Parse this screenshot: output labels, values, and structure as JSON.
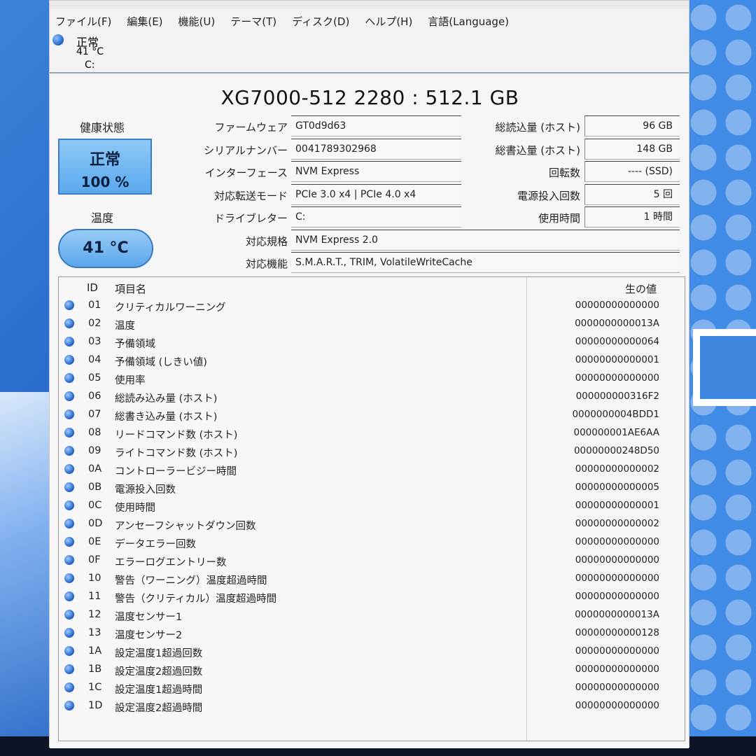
{
  "menu": [
    "ファイル(F)",
    "編集(E)",
    "機能(U)",
    "テーマ(T)",
    "ディスク(D)",
    "ヘルプ(H)",
    "言語(Language)"
  ],
  "drive_tab": {
    "status": "正常",
    "temperature": "41 °C",
    "letter": "C:"
  },
  "disk_title": "XG7000-512 2280 : 512.1 GB",
  "health": {
    "label": "健康状態",
    "status": "正常",
    "percent": "100 %"
  },
  "temperature": {
    "label": "温度",
    "value": "41 °C"
  },
  "info": {
    "firmware": {
      "label": "ファームウェア",
      "value": "GT0d9d63"
    },
    "serial": {
      "label": "シリアルナンバー",
      "value": "0041789302968"
    },
    "interface": {
      "label": "インターフェース",
      "value": "NVM Express"
    },
    "transfer_mode": {
      "label": "対応転送モード",
      "value": "PCIe 3.0 x4 | PCIe 4.0 x4"
    },
    "drive_letter": {
      "label": "ドライブレター",
      "value": "C:"
    },
    "standard": {
      "label": "対応規格",
      "value": "NVM Express 2.0"
    },
    "features": {
      "label": "対応機能",
      "value": "S.M.A.R.T., TRIM, VolatileWriteCache"
    }
  },
  "stats": {
    "host_reads": {
      "label": "総読込量 (ホスト)",
      "value": "96 GB"
    },
    "host_writes": {
      "label": "総書込量 (ホスト)",
      "value": "148 GB"
    },
    "rotation": {
      "label": "回転数",
      "value": "---- (SSD)"
    },
    "power_on_count": {
      "label": "電源投入回数",
      "value": "5 回"
    },
    "power_on_hours": {
      "label": "使用時間",
      "value": "1 時間"
    }
  },
  "smart": {
    "headers": {
      "id": "ID",
      "name": "項目名",
      "raw": "生の値"
    },
    "rows": [
      {
        "id": "01",
        "name": "クリティカルワーニング",
        "raw": "00000000000000"
      },
      {
        "id": "02",
        "name": "温度",
        "raw": "0000000000013A"
      },
      {
        "id": "03",
        "name": "予備領域",
        "raw": "00000000000064"
      },
      {
        "id": "04",
        "name": "予備領域 (しきい値)",
        "raw": "00000000000001"
      },
      {
        "id": "05",
        "name": "使用率",
        "raw": "00000000000000"
      },
      {
        "id": "06",
        "name": "総読み込み量 (ホスト)",
        "raw": "000000000316F2"
      },
      {
        "id": "07",
        "name": "総書き込み量 (ホスト)",
        "raw": "0000000004BDD1"
      },
      {
        "id": "08",
        "name": "リードコマンド数 (ホスト)",
        "raw": "000000001AE6AA"
      },
      {
        "id": "09",
        "name": "ライトコマンド数 (ホスト)",
        "raw": "00000000248D50"
      },
      {
        "id": "0A",
        "name": "コントローラービジー時間",
        "raw": "00000000000002"
      },
      {
        "id": "0B",
        "name": "電源投入回数",
        "raw": "00000000000005"
      },
      {
        "id": "0C",
        "name": "使用時間",
        "raw": "00000000000001"
      },
      {
        "id": "0D",
        "name": "アンセーフシャットダウン回数",
        "raw": "00000000000002"
      },
      {
        "id": "0E",
        "name": "データエラー回数",
        "raw": "00000000000000"
      },
      {
        "id": "0F",
        "name": "エラーログエントリー数",
        "raw": "00000000000000"
      },
      {
        "id": "10",
        "name": "警告（ワーニング）温度超過時間",
        "raw": "00000000000000"
      },
      {
        "id": "11",
        "name": "警告（クリティカル）温度超過時間",
        "raw": "00000000000000"
      },
      {
        "id": "12",
        "name": "温度センサー1",
        "raw": "0000000000013A"
      },
      {
        "id": "13",
        "name": "温度センサー2",
        "raw": "00000000000128"
      },
      {
        "id": "1A",
        "name": "設定温度1超過回数",
        "raw": "00000000000000"
      },
      {
        "id": "1B",
        "name": "設定温度2超過回数",
        "raw": "00000000000000"
      },
      {
        "id": "1C",
        "name": "設定温度1超過時間",
        "raw": "00000000000000"
      },
      {
        "id": "1D",
        "name": "設定温度2超過時間",
        "raw": "00000000000000"
      }
    ]
  }
}
